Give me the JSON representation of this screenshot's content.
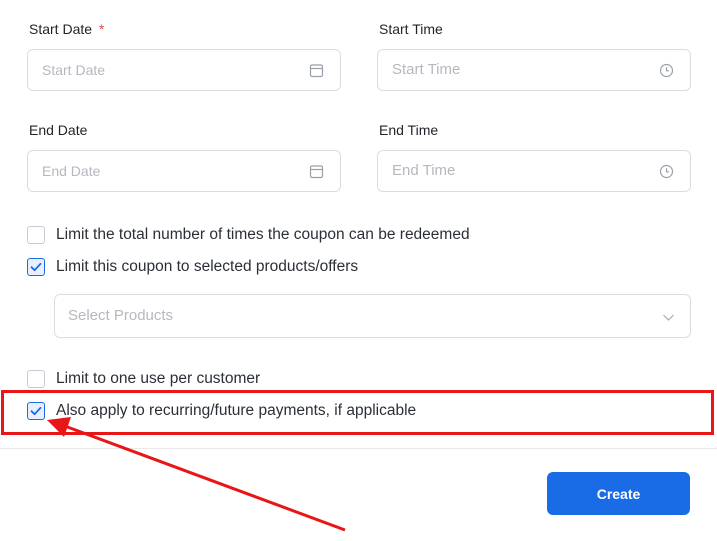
{
  "form": {
    "start_date": {
      "label": "Start Date",
      "required_mark": "*",
      "placeholder": "Start Date",
      "icon": "calendar-icon"
    },
    "start_time": {
      "label": "Start Time",
      "placeholder": "Start Time",
      "icon": "clock-icon"
    },
    "end_date": {
      "label": "End Date",
      "placeholder": "End Date",
      "icon": "calendar-icon"
    },
    "end_time": {
      "label": "End Time",
      "placeholder": "End Time",
      "icon": "clock-icon"
    },
    "options": [
      {
        "label": "Limit the total number of times the coupon can be redeemed",
        "checked": false
      },
      {
        "label": "Limit this coupon to selected products/offers",
        "checked": true
      },
      {
        "label": "Limit to one use per customer",
        "checked": false
      },
      {
        "label": "Also apply to recurring/future payments, if applicable",
        "checked": true
      }
    ],
    "select_products": {
      "placeholder": "Select Products",
      "icon": "chevron-down-icon"
    },
    "create_label": "Create"
  },
  "annotation": {
    "highlight_color": "#e81616",
    "arrow_color": "#e81616"
  },
  "colors": {
    "accent": "#1a6be6",
    "check_bg": "#e8f0fe"
  }
}
